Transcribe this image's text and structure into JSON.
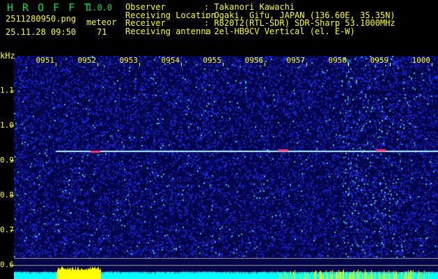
{
  "app": {
    "name": "H R O F F T",
    "version": "1.0.0"
  },
  "file": {
    "name": "2511280950.png",
    "datetime": "25.11.28 09:50"
  },
  "meteor": {
    "label": "meteor",
    "count": "71"
  },
  "info": [
    {
      "label": "Observer",
      "value": ": Takanori Kawachi"
    },
    {
      "label": "Receiving Location",
      "value": ": Ogaki, Gifu, JAPAN (136.60E, 35.35N)"
    },
    {
      "label": "Receiver",
      "value": ": R820T2(RTL-SDR) SDR-Sharp 53.1000MHz"
    },
    {
      "label": "Receiving antenna",
      "value": ": 2el-HB9CV Vertical (el. E-W)"
    }
  ],
  "axis": {
    "unit": "kHz",
    "y_ticks": [
      "1.1",
      "1.0",
      "0.9",
      "0.8",
      "0.7",
      "0.6"
    ],
    "x_ticks": [
      "0951",
      "0952",
      "0953",
      "0954",
      "0955",
      "0956",
      "0957",
      "0958",
      "0959",
      "1000"
    ]
  },
  "colors": {
    "text": "#ffff00",
    "title": "#00e040",
    "background": "#0a0a70",
    "level_bars": "#ffff00",
    "base": "#00ffff"
  }
}
